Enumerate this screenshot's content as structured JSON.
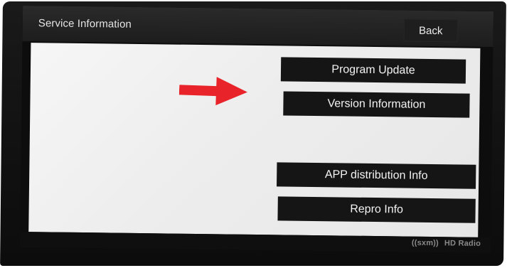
{
  "header": {
    "title": "Service Information",
    "back_label": "Back"
  },
  "menu": {
    "items": [
      {
        "label": "Program Update"
      },
      {
        "label": "Version Information"
      },
      {
        "label": "APP distribution Info"
      },
      {
        "label": "Repro Info"
      }
    ]
  },
  "annotation": {
    "arrow_color": "#e8242a",
    "arrow_target": "Version Information"
  },
  "status_bar": {
    "logos": [
      "((sxm))",
      "HD Radio"
    ]
  },
  "colors": {
    "button_bg": "#151515",
    "panel_bg": "#f0f0f0",
    "bezel": "#121212"
  }
}
